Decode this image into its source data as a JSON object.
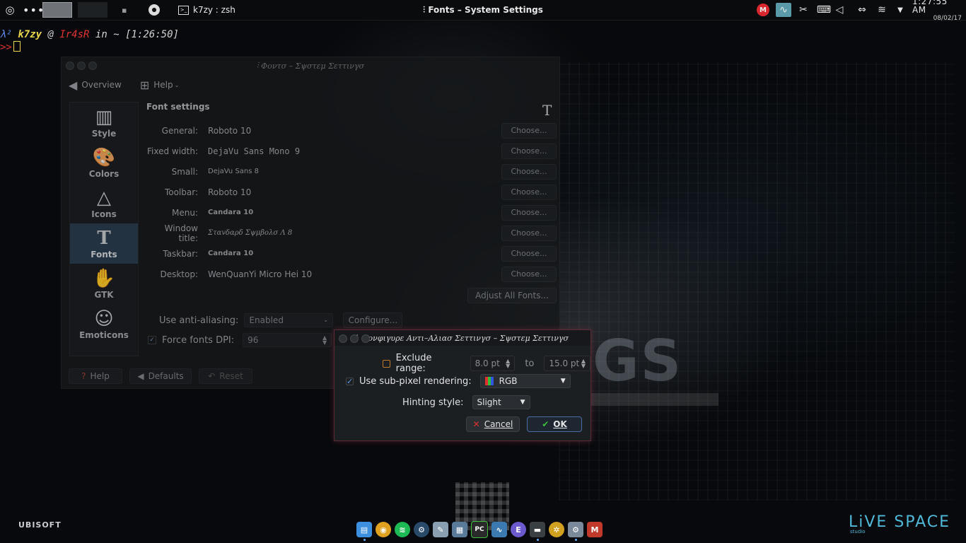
{
  "panel": {
    "terminal_task": "k7zy : zsh",
    "active_window_title": "Fonts – System Settings",
    "clock_time": "1:27:55 AM",
    "clock_date": "08/02/17",
    "mega_label": "M"
  },
  "terminal": {
    "lambda": "λ²",
    "user": "k7zy",
    "at": "@",
    "host": "Ir4sR",
    "in": "in ~",
    "time": "[1:26:50]",
    "prompt2": ">>"
  },
  "settings_window": {
    "title": "Φοντσ – Σψστεμ Σεττινγσ",
    "toolbar": {
      "overview": "Overview",
      "help": "Help"
    },
    "sidebar": [
      {
        "label": "Style",
        "icon": "style-icon",
        "glyph": "▥"
      },
      {
        "label": "Colors",
        "icon": "palette-icon",
        "glyph": "🎨"
      },
      {
        "label": "Icons",
        "icon": "icons-icon",
        "glyph": "△"
      },
      {
        "label": "Fonts",
        "icon": "fonts-icon",
        "glyph": "T"
      },
      {
        "label": "GTK",
        "icon": "gtk-icon",
        "glyph": "✋"
      },
      {
        "label": "Emoticons",
        "icon": "emoticons-icon",
        "glyph": "☺"
      }
    ],
    "section_title": "Font settings",
    "section_icon": "T",
    "fonts": [
      {
        "label": "General:",
        "value": "Roboto 10",
        "button": "Choose..."
      },
      {
        "label": "Fixed width:",
        "value": "DejaVu Sans Mono 9",
        "button": "Choose..."
      },
      {
        "label": "Small:",
        "value": "DejaVu Sans 8",
        "button": "Choose..."
      },
      {
        "label": "Toolbar:",
        "value": "Roboto 10",
        "button": "Choose..."
      },
      {
        "label": "Menu:",
        "value": "Candara 10",
        "button": "Choose..."
      },
      {
        "label": "Window title:",
        "value": "Σταvδαρδ Σψμβολσ Λ 8",
        "button": "Choose..."
      },
      {
        "label": "Taskbar:",
        "value": "Candara 10",
        "button": "Choose..."
      },
      {
        "label": "Desktop:",
        "value": "WenQuanYi Micro Hei 10",
        "button": "Choose..."
      }
    ],
    "adjust_all": "Adjust All Fonts...",
    "anti_aliasing_label": "Use anti-aliasing:",
    "anti_aliasing_value": "Enabled",
    "configure_button": "Configure...",
    "force_dpi_label": "Force fonts DPI:",
    "force_dpi_checked": true,
    "force_dpi_value": "96",
    "bottom": {
      "help": "Help",
      "defaults": "Defaults",
      "reset": "Reset"
    }
  },
  "aa_dialog": {
    "title": "Χονφιγυρε Αντι–Αλιασ Σεττινγσ – Σψστεμ Σεττινγσ",
    "exclude_label": "Exclude range:",
    "exclude_checked": false,
    "range_from": "8.0 pt",
    "range_to_label": "to",
    "range_to": "15.0 pt",
    "subpixel_label": "Use sub-pixel rendering:",
    "subpixel_checked": true,
    "subpixel_value": "RGB",
    "hinting_label": "Hinting style:",
    "hinting_value": "Slight",
    "cancel": "Cancel",
    "ok": "OK"
  },
  "dock": [
    {
      "name": "files",
      "color": "#3d8fe0",
      "glyph": "▤"
    },
    {
      "name": "chrome",
      "color": "#e0a020",
      "glyph": "◉"
    },
    {
      "name": "spotify",
      "color": "#1db954",
      "glyph": "≋"
    },
    {
      "name": "steam",
      "color": "#2a4a6a",
      "glyph": "⚙"
    },
    {
      "name": "editor",
      "color": "#8aa0b0",
      "glyph": "✎"
    },
    {
      "name": "notes",
      "color": "#5a7a9a",
      "glyph": "▦"
    },
    {
      "name": "pycharm",
      "color": "#2a2a2a",
      "glyph": "PC"
    },
    {
      "name": "monitor",
      "color": "#3a7ab0",
      "glyph": "∿"
    },
    {
      "name": "emacs",
      "color": "#6a5acd",
      "glyph": "E"
    },
    {
      "name": "terminal",
      "color": "#3a3f44",
      "glyph": "▬"
    },
    {
      "name": "settings",
      "color": "#d0a020",
      "glyph": "✲"
    },
    {
      "name": "system-settings",
      "color": "#7a8a9a",
      "glyph": "⚙"
    },
    {
      "name": "gmail",
      "color": "#c0392b",
      "glyph": "M"
    }
  ],
  "wallpaper": {
    "ubisoft": "UBISOFT",
    "live_space": "LiVE SPACE",
    "studio": "studio",
    "big_text": "GS"
  }
}
